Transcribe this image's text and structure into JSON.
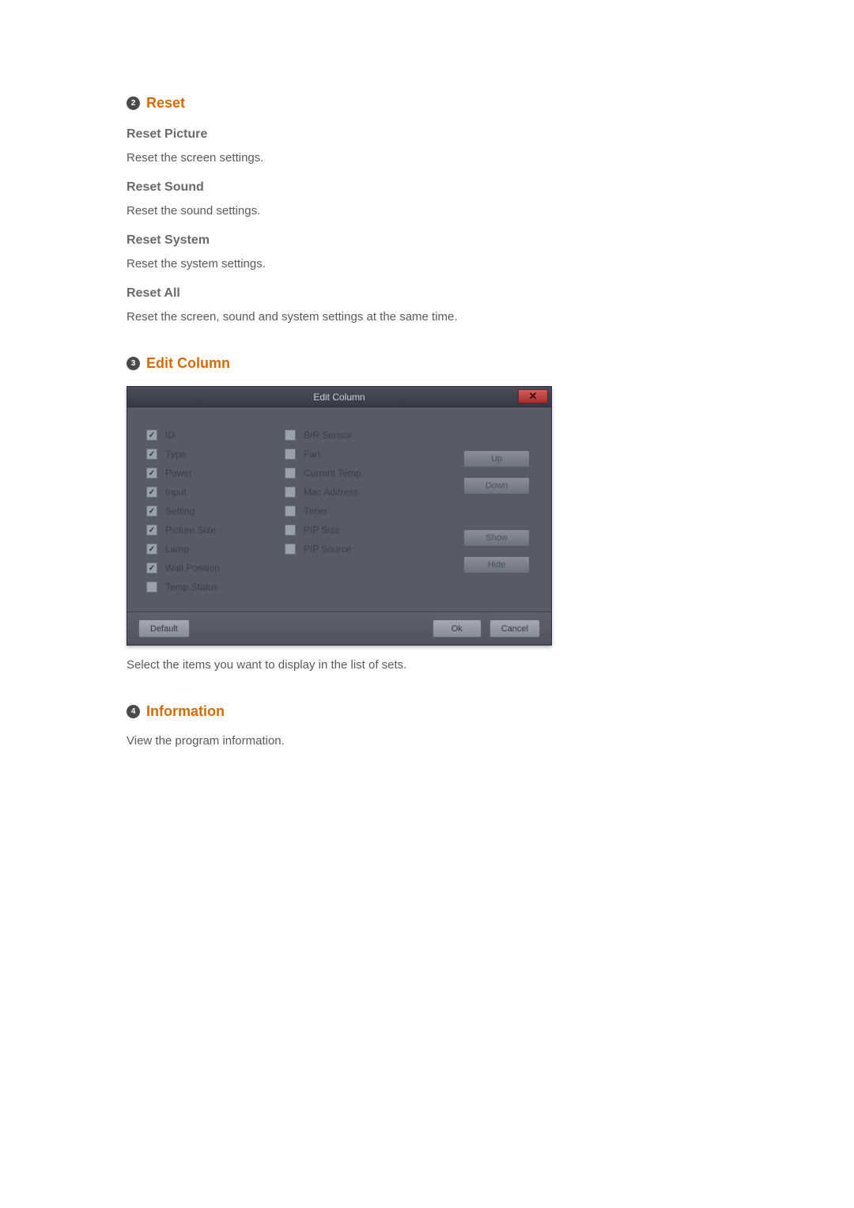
{
  "sections": {
    "reset": {
      "num": "2",
      "title": "Reset",
      "items": [
        {
          "heading": "Reset Picture",
          "desc": "Reset the screen settings."
        },
        {
          "heading": "Reset Sound",
          "desc": "Reset the sound settings."
        },
        {
          "heading": "Reset System",
          "desc": "Reset the system settings."
        },
        {
          "heading": "Reset All",
          "desc": "Reset the screen, sound and system settings at the same time."
        }
      ]
    },
    "editColumn": {
      "num": "3",
      "title": "Edit Column",
      "dialogTitle": "Edit Column",
      "leftItems": [
        {
          "label": "ID",
          "checked": true
        },
        {
          "label": "Type",
          "checked": true
        },
        {
          "label": "Power",
          "checked": true
        },
        {
          "label": "Input",
          "checked": true
        },
        {
          "label": "Setting",
          "checked": true
        },
        {
          "label": "Picture Size",
          "checked": true
        },
        {
          "label": "Lamp",
          "checked": true
        },
        {
          "label": "Wall Position",
          "checked": true
        },
        {
          "label": "Temp.Status",
          "checked": false
        }
      ],
      "midItems": [
        {
          "label": "B/R Sensor",
          "checked": false
        },
        {
          "label": "Fan",
          "checked": false
        },
        {
          "label": "Current Temp.",
          "checked": false
        },
        {
          "label": "Mac Address",
          "checked": false
        },
        {
          "label": "Timer",
          "checked": false
        },
        {
          "label": "PIP Size",
          "checked": false
        },
        {
          "label": "PIP Source",
          "checked": false
        }
      ],
      "buttons": {
        "up": "Up",
        "down": "Down",
        "show": "Show",
        "hide": "Hide",
        "default": "Default",
        "ok": "Ok",
        "cancel": "Cancel"
      },
      "desc": "Select the items you want to display in the list of sets."
    },
    "information": {
      "num": "4",
      "title": "Information",
      "desc": "View the program information."
    }
  }
}
